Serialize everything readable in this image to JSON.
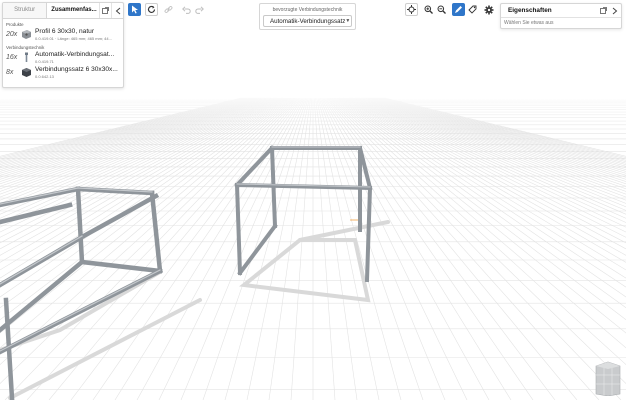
{
  "left_panel": {
    "tabs": [
      {
        "label": "Struktur",
        "active": false
      },
      {
        "label": "Zusammenfas...",
        "active": true
      }
    ],
    "sections": [
      {
        "heading": "Produkte",
        "items": [
          {
            "qty": "20x",
            "name": "Profil 6 30x30, natur",
            "sub": "0.0.419.01 · Länge: 465 mm; 465 mm; 44..."
          }
        ]
      },
      {
        "heading": "Verbindungstechnik",
        "items": [
          {
            "qty": "16x",
            "name": "Automatik-Verbindungsat...",
            "sub": "0.0.419.71"
          },
          {
            "qty": "8x",
            "name": "Verbindungssatz 6 30x30x...",
            "sub": "0.0.642.13"
          }
        ]
      }
    ]
  },
  "toolbar": {
    "select_icon": "cursor-icon",
    "refresh_icon": "refresh-icon",
    "link_icon": "link-icon",
    "undo_icon": "undo-icon",
    "redo_icon": "redo-icon"
  },
  "connection": {
    "label": "bevorzugte Verbindungstechnik",
    "selected": "Automatik-Verbindungssatz"
  },
  "view_tools": [
    "target-icon",
    "zoom-in-icon",
    "zoom-out-icon",
    "pen-icon",
    "tag-icon",
    "settings-icon"
  ],
  "properties": {
    "title": "Eigenschaften",
    "hint": "Wählen Sie etwas aus"
  },
  "colors": {
    "accent": "#2f76c9",
    "profile": "#9ba0a6",
    "grid": "#e4e4e4"
  }
}
